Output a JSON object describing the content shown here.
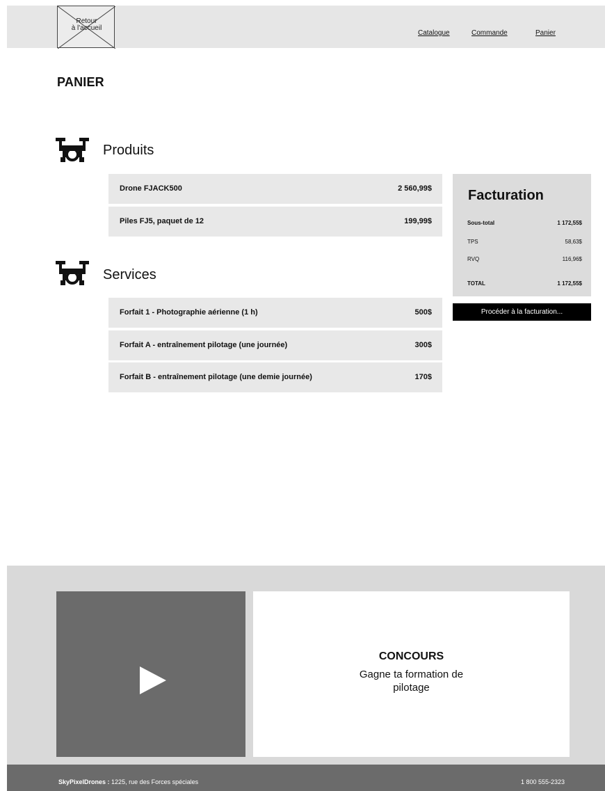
{
  "header": {
    "logo_text": "Retour\nà l'accueil",
    "nav": [
      "Catalogue",
      "Commande",
      "Panier"
    ]
  },
  "page_title": "PANIER",
  "products": {
    "title": "Produits",
    "items": [
      {
        "label": "Drone FJACK500",
        "price": "2 560,99$"
      },
      {
        "label": "Piles FJ5, paquet de 12",
        "price": "199,99$"
      }
    ]
  },
  "services": {
    "title": "Services",
    "items": [
      {
        "label": "Forfait 1 - Photographie aérienne (1 h)",
        "price": "500$"
      },
      {
        "label": "Forfait A - entraînement pilotage (une journée)",
        "price": "300$"
      },
      {
        "label": "Forfait B - entraînement pilotage (une demie journée)",
        "price": "170$"
      }
    ]
  },
  "billing": {
    "title": "Facturation",
    "lines": [
      {
        "label": "Sous-total",
        "value": "1 172,55$"
      },
      {
        "label": "TPS",
        "value": "58,63$"
      },
      {
        "label": "RVQ",
        "value": "116,96$"
      }
    ],
    "total_label": "TOTAL",
    "total_value": "1 172,55$",
    "button": "Procéder à la facturation..."
  },
  "banner": {
    "title": "CONCOURS",
    "text": "Gagne ta formation de pilotage"
  },
  "footer": {
    "company": "SkyPixelDrones :",
    "address": " 1225, rue des Forces spéciales",
    "phone": "1 800 555-2323"
  }
}
